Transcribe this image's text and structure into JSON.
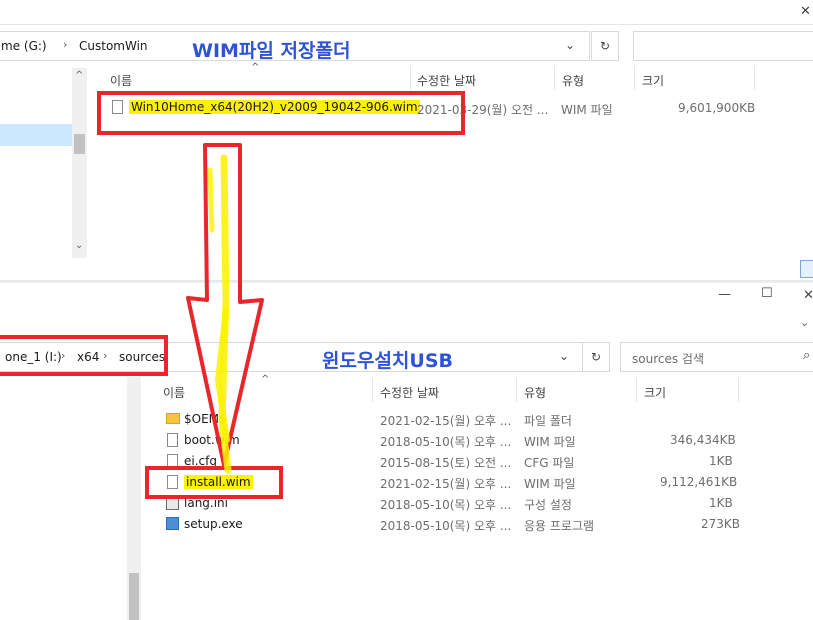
{
  "win1": {
    "breadcrumb": [
      "me (G:)",
      "CustomWin"
    ],
    "annotation_title": "WIM파일 저장폴더",
    "headers": {
      "name": "이름",
      "date": "수정한 날짜",
      "type": "유형",
      "size": "크기"
    },
    "files": [
      {
        "name": "Win10Home_x64(20H2)_v2009_19042-906.wim",
        "date": "2021-03-29(월) 오전 ...",
        "type": "WIM 파일",
        "size": "9,601,900KB"
      }
    ]
  },
  "win2": {
    "breadcrumb": [
      "one_1 (I:)",
      "x64",
      "sources"
    ],
    "annotation_title": "윈도우설치USB",
    "search_placeholder": "sources 검색",
    "headers": {
      "name": "이름",
      "date": "수정한 날짜",
      "type": "유형",
      "size": "크기"
    },
    "files": [
      {
        "name": "$OEM$",
        "date": "2021-02-15(월) 오후 ...",
        "type": "파일 폴더",
        "size": "",
        "icon": "folder-icon"
      },
      {
        "name": "boot.wim",
        "date": "2018-05-10(목) 오후 ...",
        "type": "WIM 파일",
        "size": "346,434KB",
        "icon": "file-icon"
      },
      {
        "name": "ei.cfg",
        "date": "2015-08-15(토) 오전 ...",
        "type": "CFG 파일",
        "size": "1KB",
        "icon": "file-icon"
      },
      {
        "name": "install.wim",
        "date": "2021-02-15(월) 오후 ...",
        "type": "WIM 파일",
        "size": "9,112,461KB",
        "icon": "file-icon"
      },
      {
        "name": "lang.ini",
        "date": "2018-05-10(목) 오후 ...",
        "type": "구성 설정",
        "size": "1KB",
        "icon": "settings-file-icon"
      },
      {
        "name": "setup.exe",
        "date": "2018-05-10(목) 오후 ...",
        "type": "응용 프로그램",
        "size": "273KB",
        "icon": "setup-exe-icon"
      }
    ]
  },
  "colors": {
    "annotation_red": "#e8262c",
    "highlight_yellow": "#fbf100",
    "annotation_blue": "#2f53d6"
  }
}
